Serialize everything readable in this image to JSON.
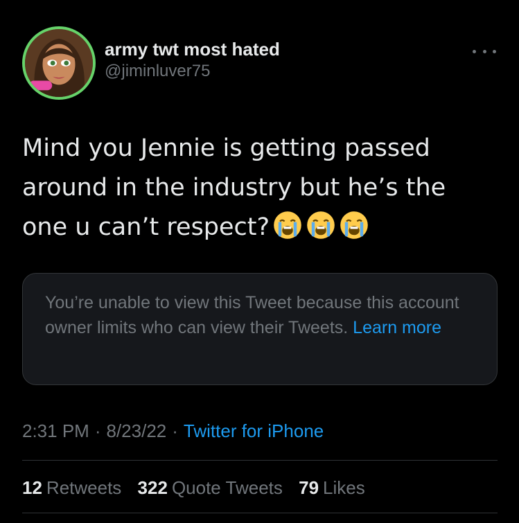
{
  "author": {
    "display_name": "army twt most hated",
    "handle": "@jiminluver75",
    "avatar_icon": "cartoon-doll-avatar",
    "avatar_ring_color": "#66d36a",
    "avatar_badge_text": "Bratz"
  },
  "more_icon": "more-horizontal-icon",
  "tweet": {
    "text": "Mind you Jennie is getting passed\naround in the industry but he’s the\none u can’t respect?",
    "emojis": [
      "loudly-crying-face-icon",
      "loudly-crying-face-icon",
      "loudly-crying-face-icon"
    ]
  },
  "notice": {
    "text": "You’re unable to view this Tweet because this account owner limits who can view their Tweets.",
    "link_label": "Learn more"
  },
  "meta": {
    "time": "2:31 PM",
    "separator": "·",
    "date": "8/23/22",
    "source": "Twitter for iPhone"
  },
  "stats": {
    "retweets_count": "12",
    "retweets_label": "Retweets",
    "quotes_count": "322",
    "quotes_label": "Quote Tweets",
    "likes_count": "79",
    "likes_label": "Likes"
  },
  "colors": {
    "background": "#000000",
    "primary_text": "#e7e9ea",
    "secondary_text": "#71767b",
    "link": "#1d9bf0",
    "card_bg": "#16181c",
    "border": "#2f3336"
  }
}
